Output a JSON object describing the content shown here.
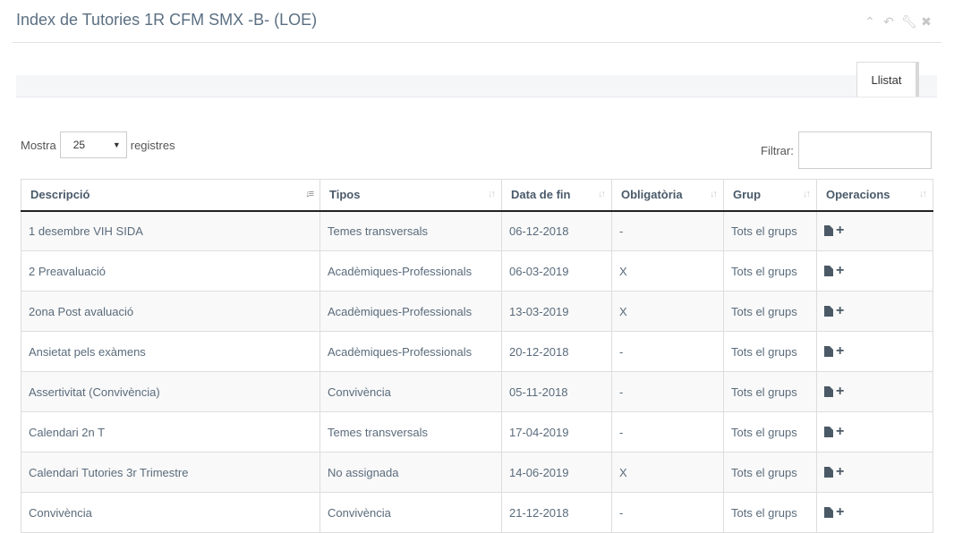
{
  "header": {
    "title": "Index de Tutories 1R CFM SMX -B- (LOE)",
    "controls": [
      "chevron-up-icon",
      "reply-icon",
      "wrench-icon",
      "close-icon"
    ]
  },
  "tabs": [
    {
      "label": "Llistat",
      "active": true
    }
  ],
  "length_control": {
    "prefix": "Mostra",
    "value": "25",
    "suffix": "registres"
  },
  "filter": {
    "label": "Filtrar:",
    "value": ""
  },
  "table": {
    "columns": [
      "Descripció",
      "Tipos",
      "Data de fin",
      "Obligatòria",
      "Grup",
      "Operacions"
    ],
    "sorted_column": "Descripció",
    "rows": [
      {
        "desc": "1 desembre VIH SIDA",
        "tipo": "Temes transversals",
        "data": "06-12-2018",
        "oblig": "-",
        "grup": "Tots el grups"
      },
      {
        "desc": "2 Preavaluació",
        "tipo": "Acadèmiques-Professionals",
        "data": "06-03-2019",
        "oblig": "X",
        "grup": "Tots el grups"
      },
      {
        "desc": "2ona Post avaluació",
        "tipo": "Acadèmiques-Professionals",
        "data": "13-03-2019",
        "oblig": "X",
        "grup": "Tots el grups"
      },
      {
        "desc": "Ansietat pels exàmens",
        "tipo": "Acadèmiques-Professionals",
        "data": "20-12-2018",
        "oblig": "-",
        "grup": "Tots el grups"
      },
      {
        "desc": "Assertivitat (Convivència)",
        "tipo": "Convivència",
        "data": "05-11-2018",
        "oblig": "-",
        "grup": "Tots el grups"
      },
      {
        "desc": "Calendari 2n T",
        "tipo": "Temes transversals",
        "data": "17-04-2019",
        "oblig": "-",
        "grup": "Tots el grups"
      },
      {
        "desc": "Calendari Tutories 3r Trimestre",
        "tipo": "No assignada",
        "data": "14-06-2019",
        "oblig": "X",
        "grup": "Tots el grups"
      },
      {
        "desc": "Convivència",
        "tipo": "Convivència",
        "data": "21-12-2018",
        "oblig": "-",
        "grup": "Tots el grups"
      }
    ]
  },
  "colors": {
    "title": "#5b6f82",
    "header_text": "#4a5a6a",
    "cell_text": "#5a6b7b",
    "icon": "#4b5966",
    "stripe": "#f9f9f9"
  }
}
